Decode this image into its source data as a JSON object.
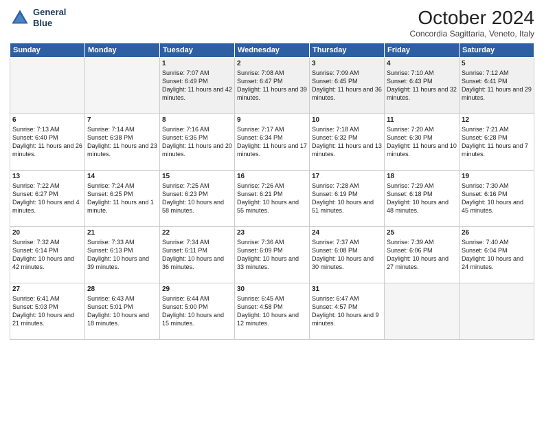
{
  "header": {
    "logo_line1": "General",
    "logo_line2": "Blue",
    "month": "October 2024",
    "location": "Concordia Sagittaria, Veneto, Italy"
  },
  "days_of_week": [
    "Sunday",
    "Monday",
    "Tuesday",
    "Wednesday",
    "Thursday",
    "Friday",
    "Saturday"
  ],
  "weeks": [
    [
      {
        "num": "",
        "empty": true
      },
      {
        "num": "",
        "empty": true
      },
      {
        "num": "1",
        "sunrise": "7:07 AM",
        "sunset": "6:49 PM",
        "daylight": "11 hours and 42 minutes."
      },
      {
        "num": "2",
        "sunrise": "7:08 AM",
        "sunset": "6:47 PM",
        "daylight": "11 hours and 39 minutes."
      },
      {
        "num": "3",
        "sunrise": "7:09 AM",
        "sunset": "6:45 PM",
        "daylight": "11 hours and 36 minutes."
      },
      {
        "num": "4",
        "sunrise": "7:10 AM",
        "sunset": "6:43 PM",
        "daylight": "11 hours and 32 minutes."
      },
      {
        "num": "5",
        "sunrise": "7:12 AM",
        "sunset": "6:41 PM",
        "daylight": "11 hours and 29 minutes."
      }
    ],
    [
      {
        "num": "6",
        "sunrise": "7:13 AM",
        "sunset": "6:40 PM",
        "daylight": "11 hours and 26 minutes."
      },
      {
        "num": "7",
        "sunrise": "7:14 AM",
        "sunset": "6:38 PM",
        "daylight": "11 hours and 23 minutes."
      },
      {
        "num": "8",
        "sunrise": "7:16 AM",
        "sunset": "6:36 PM",
        "daylight": "11 hours and 20 minutes."
      },
      {
        "num": "9",
        "sunrise": "7:17 AM",
        "sunset": "6:34 PM",
        "daylight": "11 hours and 17 minutes."
      },
      {
        "num": "10",
        "sunrise": "7:18 AM",
        "sunset": "6:32 PM",
        "daylight": "11 hours and 13 minutes."
      },
      {
        "num": "11",
        "sunrise": "7:20 AM",
        "sunset": "6:30 PM",
        "daylight": "11 hours and 10 minutes."
      },
      {
        "num": "12",
        "sunrise": "7:21 AM",
        "sunset": "6:28 PM",
        "daylight": "11 hours and 7 minutes."
      }
    ],
    [
      {
        "num": "13",
        "sunrise": "7:22 AM",
        "sunset": "6:27 PM",
        "daylight": "10 hours and 4 minutes."
      },
      {
        "num": "14",
        "sunrise": "7:24 AM",
        "sunset": "6:25 PM",
        "daylight": "11 hours and 1 minute."
      },
      {
        "num": "15",
        "sunrise": "7:25 AM",
        "sunset": "6:23 PM",
        "daylight": "10 hours and 58 minutes."
      },
      {
        "num": "16",
        "sunrise": "7:26 AM",
        "sunset": "6:21 PM",
        "daylight": "10 hours and 55 minutes."
      },
      {
        "num": "17",
        "sunrise": "7:28 AM",
        "sunset": "6:19 PM",
        "daylight": "10 hours and 51 minutes."
      },
      {
        "num": "18",
        "sunrise": "7:29 AM",
        "sunset": "6:18 PM",
        "daylight": "10 hours and 48 minutes."
      },
      {
        "num": "19",
        "sunrise": "7:30 AM",
        "sunset": "6:16 PM",
        "daylight": "10 hours and 45 minutes."
      }
    ],
    [
      {
        "num": "20",
        "sunrise": "7:32 AM",
        "sunset": "6:14 PM",
        "daylight": "10 hours and 42 minutes."
      },
      {
        "num": "21",
        "sunrise": "7:33 AM",
        "sunset": "6:13 PM",
        "daylight": "10 hours and 39 minutes."
      },
      {
        "num": "22",
        "sunrise": "7:34 AM",
        "sunset": "6:11 PM",
        "daylight": "10 hours and 36 minutes."
      },
      {
        "num": "23",
        "sunrise": "7:36 AM",
        "sunset": "6:09 PM",
        "daylight": "10 hours and 33 minutes."
      },
      {
        "num": "24",
        "sunrise": "7:37 AM",
        "sunset": "6:08 PM",
        "daylight": "10 hours and 30 minutes."
      },
      {
        "num": "25",
        "sunrise": "7:39 AM",
        "sunset": "6:06 PM",
        "daylight": "10 hours and 27 minutes."
      },
      {
        "num": "26",
        "sunrise": "7:40 AM",
        "sunset": "6:04 PM",
        "daylight": "10 hours and 24 minutes."
      }
    ],
    [
      {
        "num": "27",
        "sunrise": "6:41 AM",
        "sunset": "5:03 PM",
        "daylight": "10 hours and 21 minutes."
      },
      {
        "num": "28",
        "sunrise": "6:43 AM",
        "sunset": "5:01 PM",
        "daylight": "10 hours and 18 minutes."
      },
      {
        "num": "29",
        "sunrise": "6:44 AM",
        "sunset": "5:00 PM",
        "daylight": "10 hours and 15 minutes."
      },
      {
        "num": "30",
        "sunrise": "6:45 AM",
        "sunset": "4:58 PM",
        "daylight": "10 hours and 12 minutes."
      },
      {
        "num": "31",
        "sunrise": "6:47 AM",
        "sunset": "4:57 PM",
        "daylight": "10 hours and 9 minutes."
      },
      {
        "num": "",
        "empty": true
      },
      {
        "num": "",
        "empty": true
      }
    ]
  ]
}
